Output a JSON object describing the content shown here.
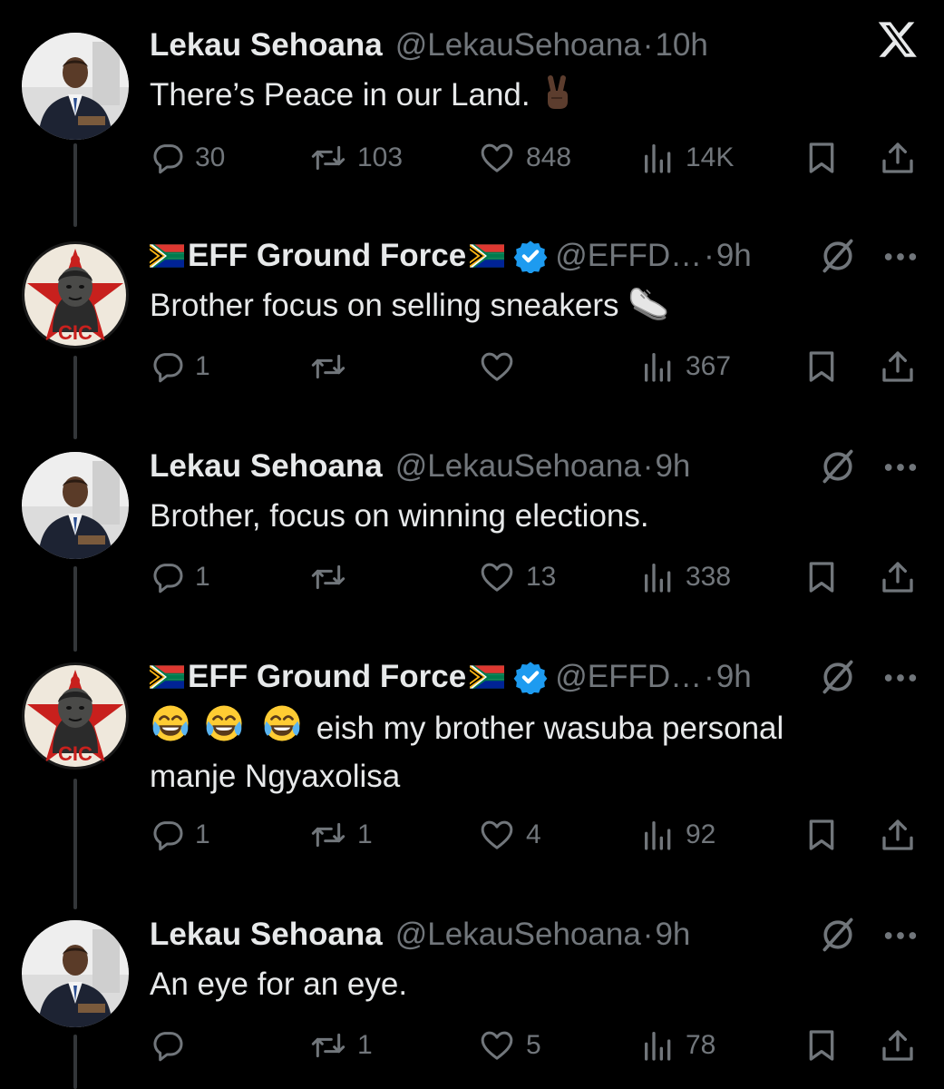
{
  "tweets": [
    {
      "author": "Lekau Sehoana",
      "handle": "@LekauSehoana",
      "separator": "·",
      "time": "10h",
      "text": "There’s Peace in our Land.",
      "avatar": "lekau-avatar",
      "counts": {
        "replies": "30",
        "retweets": "103",
        "likes": "848",
        "views": "14K"
      }
    },
    {
      "author": "EFF Ground Force",
      "handle": "@EFFD…",
      "separator": "·",
      "time": "9h",
      "text": "Brother focus on selling sneakers",
      "avatar": "eff-cic-avatar",
      "verified": true,
      "counts": {
        "replies": "1",
        "retweets": "",
        "likes": "",
        "views": "367"
      }
    },
    {
      "author": "Lekau Sehoana",
      "handle": "@LekauSehoana",
      "separator": "·",
      "time": "9h",
      "text": "Brother, focus on winning elections.",
      "avatar": "lekau-avatar",
      "counts": {
        "replies": "1",
        "retweets": "",
        "likes": "13",
        "views": "338"
      }
    },
    {
      "author": "EFF Ground Force",
      "handle": "@EFFD…",
      "separator": "·",
      "time": "9h",
      "text_line1": "eish my brother wasuba personal",
      "text_line2": "manje Ngyaxolisa",
      "avatar": "eff-cic-avatar",
      "verified": true,
      "counts": {
        "replies": "1",
        "retweets": "1",
        "likes": "4",
        "views": "92"
      }
    },
    {
      "author": "Lekau Sehoana",
      "handle": "@LekauSehoana",
      "separator": "·",
      "time": "9h",
      "text": "An eye for an eye.",
      "avatar": "lekau-avatar",
      "counts": {
        "replies": "",
        "retweets": "1",
        "likes": "5",
        "views": "78"
      }
    }
  ],
  "avatar_badge": "CIC",
  "icons": [
    "x-logo-icon",
    "grok-icon",
    "more-icon",
    "reply-icon",
    "retweet-icon",
    "like-icon",
    "views-icon",
    "bookmark-icon",
    "share-icon",
    "verified-icon",
    "sa-flag-icon",
    "victory-hand-emoji",
    "sneaker-emoji",
    "laughing-tears-emoji"
  ],
  "colors": {
    "background": "#000000",
    "text": "#e7e9ea",
    "muted": "#71767b",
    "verified": "#1d9bf0",
    "thread_line": "#333639"
  }
}
